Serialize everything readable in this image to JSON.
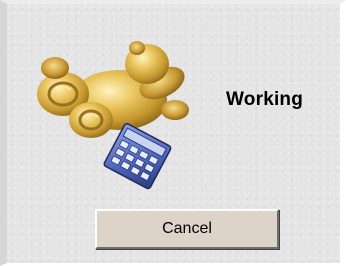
{
  "dialog": {
    "status_text": "Working",
    "cancel_label": "Cancel"
  },
  "icons": {
    "teddy": "teddy-bear-icon",
    "calculator": "calculator-icon"
  },
  "colors": {
    "background": "#e4e4e4",
    "button_face": "#ddd3c9",
    "gold": "#d9b64a",
    "calculator_blue": "#3f57a8"
  }
}
